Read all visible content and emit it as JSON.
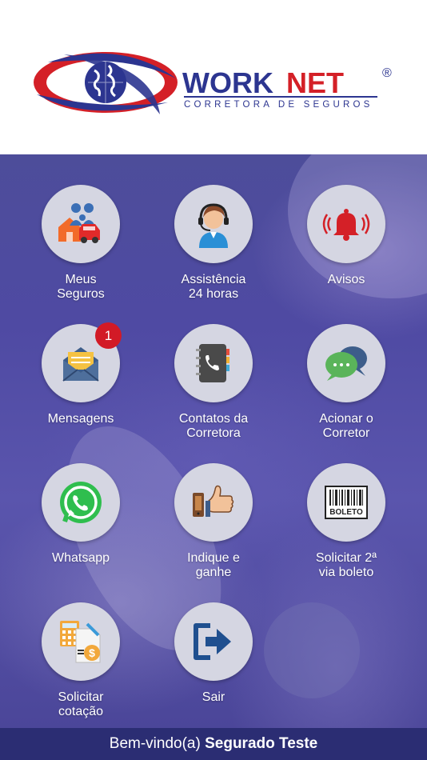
{
  "header": {
    "brand_work": "WORK",
    "brand_net": "NET",
    "registered": "®",
    "tagline": "CORRETORA DE SEGUROS"
  },
  "menu": [
    {
      "id": "meus-seguros",
      "label": "Meus\nSeguros",
      "icon": "family-house-car-icon"
    },
    {
      "id": "assistencia",
      "label": "Assistência\n24 horas",
      "icon": "headset-agent-icon"
    },
    {
      "id": "avisos",
      "label": "Avisos",
      "icon": "alarm-bell-icon"
    },
    {
      "id": "mensagens",
      "label": "Mensagens",
      "icon": "envelope-icon",
      "badge": "1"
    },
    {
      "id": "contatos",
      "label": "Contatos da\nCorretora",
      "icon": "phone-book-icon"
    },
    {
      "id": "acionar",
      "label": "Acionar o\nCorretor",
      "icon": "chat-bubbles-icon"
    },
    {
      "id": "whatsapp",
      "label": "Whatsapp",
      "icon": "whatsapp-icon"
    },
    {
      "id": "indique",
      "label": "Indique e\nganhe",
      "icon": "thumbs-up-phone-icon"
    },
    {
      "id": "boleto",
      "label": "Solicitar 2ª\nvia boleto",
      "icon": "barcode-boleto-icon",
      "barcode_text": "BOLETO"
    },
    {
      "id": "cotacao",
      "label": "Solicitar\ncotação",
      "icon": "calculator-money-icon"
    },
    {
      "id": "sair",
      "label": "Sair",
      "icon": "exit-arrow-icon"
    }
  ],
  "footer": {
    "greeting": "Bem-vindo(a)",
    "user_name": "Segurado Teste"
  },
  "colors": {
    "brand_blue": "#2c3590",
    "brand_red": "#d42027",
    "footer_bg": "#2b2d73",
    "badge_red": "#d21a26",
    "tile_bg": "#d5d6e2"
  }
}
